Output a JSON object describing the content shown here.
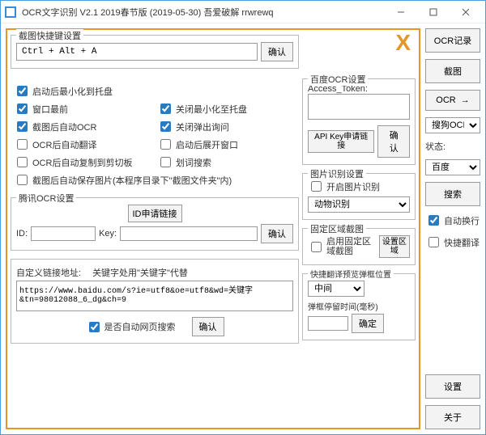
{
  "title": "OCR文字识别 V2.1    2019春节版  (2019-05-30)    吾爱破解  rrwrewq",
  "close_x": "X",
  "hotkey": {
    "group_title": "截图快捷键设置",
    "value": "Ctrl + Alt + A",
    "confirm": "确认"
  },
  "opts": {
    "c1": "启动后最小化到托盘",
    "c2": "窗口最前",
    "c3": "关闭最小化至托盘",
    "c4": "截图后自动OCR",
    "c5": "关闭弹出询问",
    "c6": "OCR后自动翻译",
    "c7": "启动后展开窗口",
    "c8": "OCR后自动复制到剪切板",
    "c9": "划词搜索",
    "c10": "截图后自动保存图片(本程序目录下\"截图文件夹\"内)"
  },
  "tencent": {
    "group_title": "腾讯OCR设置",
    "id_apply": "ID申请链接",
    "id_label": "ID:",
    "key_label": "Key:",
    "confirm": "确认"
  },
  "custom": {
    "label": "自定义链接地址:",
    "hint": "关键字处用\"关键字\"代替",
    "url": "https://www.baidu.com/s?ie=utf8&oe=utf8&wd=关键字&tn=98012088_6_dg&ch=9",
    "auto_search": "是否自动网页搜索",
    "confirm": "确认"
  },
  "baidu": {
    "group_title": "百度OCR设置",
    "token_label": "Access_Token:",
    "api_key": "API Key申请链接",
    "confirm": "确认"
  },
  "imgrec": {
    "group_title": "图片识别设置",
    "enable": "开启图片识别",
    "select_value": "动物识别"
  },
  "fixed": {
    "group_title": "固定区域截图",
    "enable": "启用固定区域截图",
    "set_region": "设置区域"
  },
  "preview": {
    "group_title": "快捷翻译预览弹框位置",
    "pos_value": "中间",
    "delay_label": "弹框停留时间(毫秒)",
    "confirm": "确定"
  },
  "side": {
    "ocr_log": "OCR记录",
    "screenshot": "截图",
    "ocr": "OCR",
    "engine_value": "搜狗OCR",
    "status_label": "状态:",
    "src_value": "百度",
    "search": "搜索",
    "auto_wrap": "自动换行",
    "quick_tr": "快捷翻译",
    "settings": "设置",
    "about": "关于"
  }
}
